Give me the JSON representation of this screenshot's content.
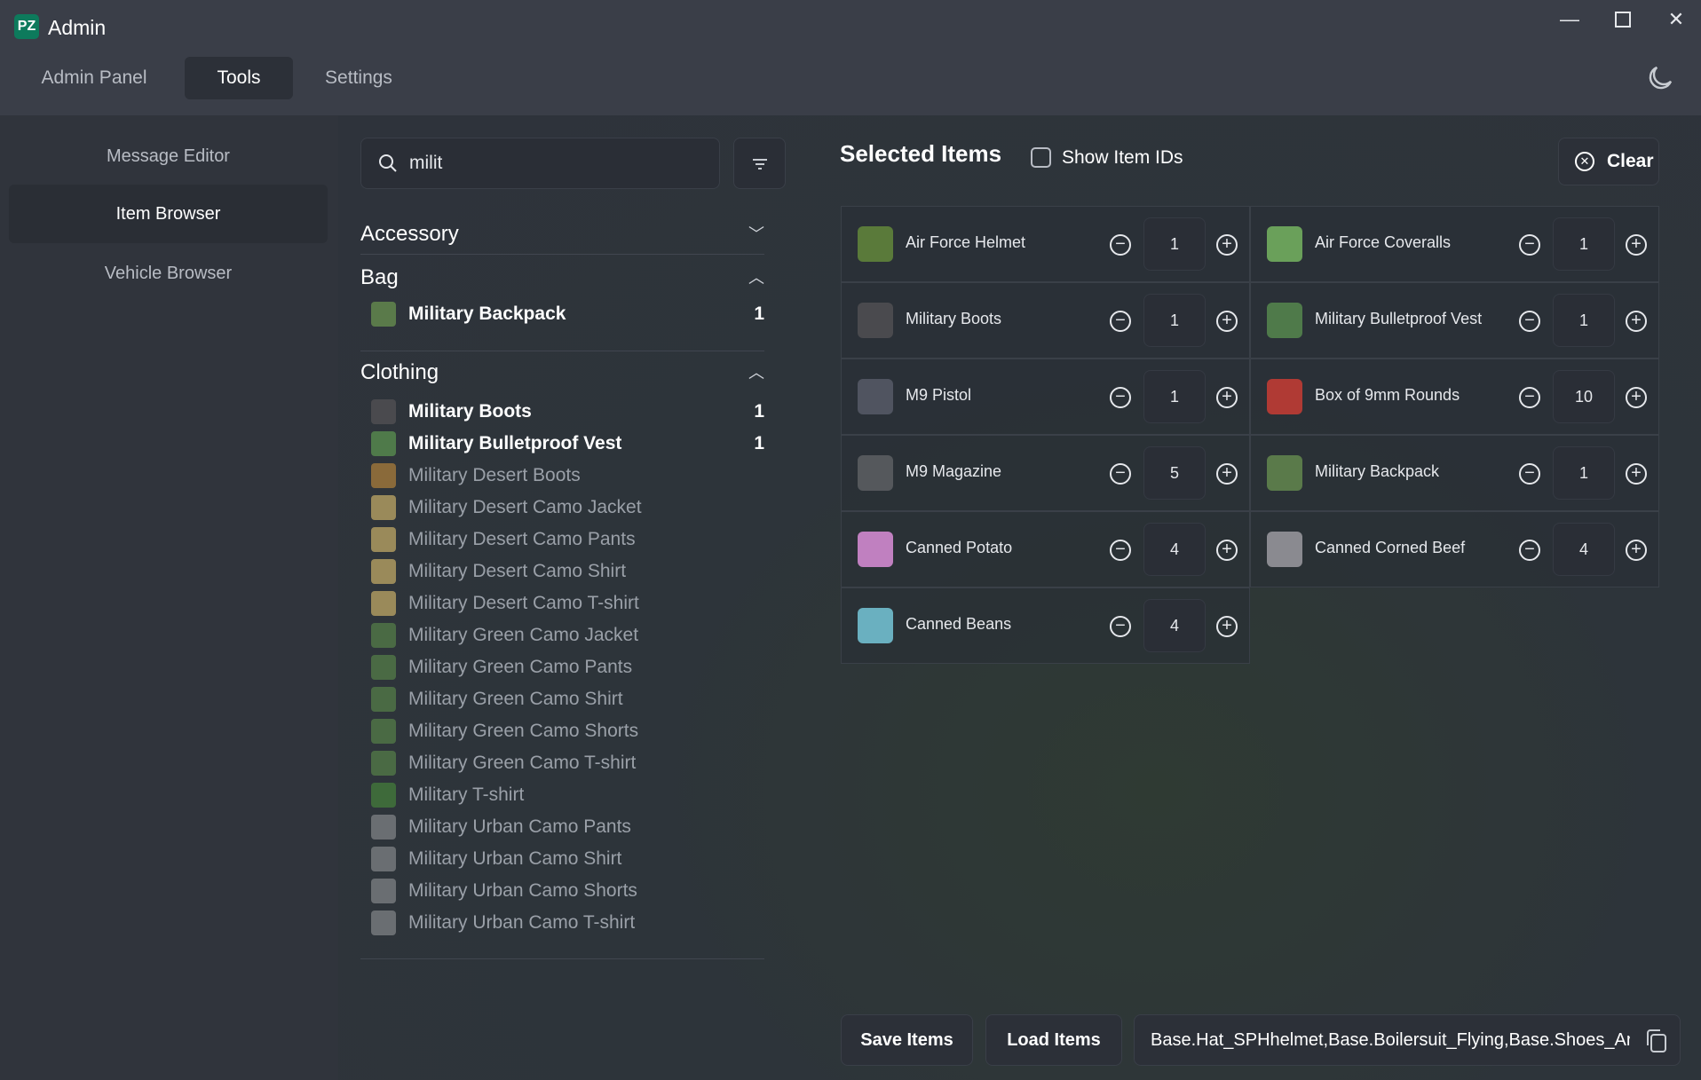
{
  "app": {
    "logo": "PZ",
    "title": "Admin"
  },
  "tabs": [
    {
      "label": "Admin Panel",
      "active": false
    },
    {
      "label": "Tools",
      "active": true
    },
    {
      "label": "Settings",
      "active": false
    }
  ],
  "window_controls": [
    "minimize-icon",
    "maximize-icon",
    "close-icon"
  ],
  "theme_icon": "moon-icon",
  "sidebar": {
    "items": [
      {
        "label": "Message Editor",
        "active": false
      },
      {
        "label": "Item Browser",
        "active": true
      },
      {
        "label": "Vehicle Browser",
        "active": false
      }
    ]
  },
  "search": {
    "value": "milit",
    "placeholder": ""
  },
  "categories": [
    {
      "name": "Accessory",
      "expanded": false,
      "items": []
    },
    {
      "name": "Bag",
      "expanded": true,
      "items": [
        {
          "name": "Military Backpack",
          "count": "1",
          "color": "#5a7a4a"
        }
      ]
    },
    {
      "name": "Clothing",
      "expanded": true,
      "items": [
        {
          "name": "Military Boots",
          "count": "1",
          "color": "#4a4a4e"
        },
        {
          "name": "Military Bulletproof Vest",
          "count": "1",
          "color": "#4f7a4a"
        },
        {
          "name": "Military Desert Boots",
          "count": "",
          "color": "#8a6a3a"
        },
        {
          "name": "Military Desert Camo Jacket",
          "count": "",
          "color": "#9a8a5a"
        },
        {
          "name": "Military Desert Camo Pants",
          "count": "",
          "color": "#9a8a5a"
        },
        {
          "name": "Military Desert Camo Shirt",
          "count": "",
          "color": "#9a8a5a"
        },
        {
          "name": "Military Desert Camo T-shirt",
          "count": "",
          "color": "#9a8a5a"
        },
        {
          "name": "Military Green Camo Jacket",
          "count": "",
          "color": "#4a6a44"
        },
        {
          "name": "Military Green Camo Pants",
          "count": "",
          "color": "#4a6a44"
        },
        {
          "name": "Military Green Camo Shirt",
          "count": "",
          "color": "#4a6a44"
        },
        {
          "name": "Military Green Camo Shorts",
          "count": "",
          "color": "#4a6a44"
        },
        {
          "name": "Military Green Camo T-shirt",
          "count": "",
          "color": "#4a6a44"
        },
        {
          "name": "Military T-shirt",
          "count": "",
          "color": "#3e6a3a"
        },
        {
          "name": "Military Urban Camo Pants",
          "count": "",
          "color": "#6a6e72"
        },
        {
          "name": "Military Urban Camo Shirt",
          "count": "",
          "color": "#6a6e72"
        },
        {
          "name": "Military Urban Camo Shorts",
          "count": "",
          "color": "#6a6e72"
        },
        {
          "name": "Military Urban Camo T-shirt",
          "count": "",
          "color": "#6a6e72"
        }
      ]
    }
  ],
  "selected": {
    "title": "Selected Items",
    "show_ids_label": "Show Item IDs",
    "show_ids": false,
    "clear_label": "Clear",
    "items": [
      {
        "name": "Air Force Helmet",
        "qty": "1",
        "color": "#5a7a3a"
      },
      {
        "name": "Air Force Coveralls",
        "qty": "1",
        "color": "#6aa05a"
      },
      {
        "name": "Military Boots",
        "qty": "1",
        "color": "#4a4a4e"
      },
      {
        "name": "Military Bulletproof Vest",
        "qty": "1",
        "color": "#4f7a4a"
      },
      {
        "name": "M9 Pistol",
        "qty": "1",
        "color": "#505460"
      },
      {
        "name": "Box of 9mm Rounds",
        "qty": "10",
        "color": "#b03a34"
      },
      {
        "name": "M9 Magazine",
        "qty": "5",
        "color": "#55585c"
      },
      {
        "name": "Military Backpack",
        "qty": "1",
        "color": "#5a7a4a"
      },
      {
        "name": "Canned Potato",
        "qty": "4",
        "color": "#c080c0"
      },
      {
        "name": "Canned Corned Beef",
        "qty": "4",
        "color": "#8a8a90"
      },
      {
        "name": "Canned Beans",
        "qty": "4",
        "color": "#6ab0c0"
      }
    ]
  },
  "footer": {
    "save_label": "Save Items",
    "load_label": "Load Items",
    "ids_value": "Base.Hat_SPHhelmet,Base.Boilersuit_Flying,Base.Shoes_Arm"
  }
}
